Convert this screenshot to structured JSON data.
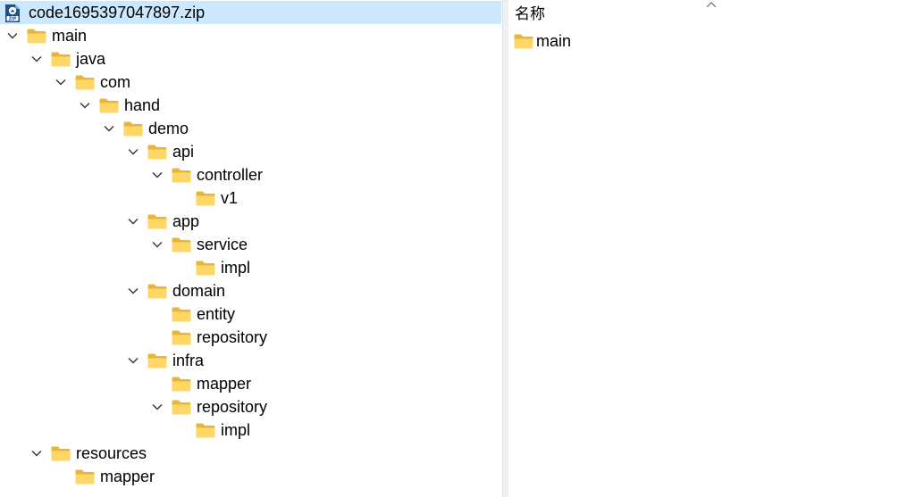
{
  "archive": {
    "name": "code1695397047897.zip",
    "icon": "zip-archive-icon"
  },
  "tree": [
    {
      "label": "main",
      "depth": 0,
      "expanded": true
    },
    {
      "label": "java",
      "depth": 1,
      "expanded": true
    },
    {
      "label": "com",
      "depth": 2,
      "expanded": true
    },
    {
      "label": "hand",
      "depth": 3,
      "expanded": true
    },
    {
      "label": "demo",
      "depth": 4,
      "expanded": true
    },
    {
      "label": "api",
      "depth": 5,
      "expanded": true
    },
    {
      "label": "controller",
      "depth": 6,
      "expanded": true
    },
    {
      "label": "v1",
      "depth": 7,
      "expanded": null
    },
    {
      "label": "app",
      "depth": 5,
      "expanded": true
    },
    {
      "label": "service",
      "depth": 6,
      "expanded": true
    },
    {
      "label": "impl",
      "depth": 7,
      "expanded": null
    },
    {
      "label": "domain",
      "depth": 5,
      "expanded": true
    },
    {
      "label": "entity",
      "depth": 6,
      "expanded": null
    },
    {
      "label": "repository",
      "depth": 6,
      "expanded": null
    },
    {
      "label": "infra",
      "depth": 5,
      "expanded": true
    },
    {
      "label": "mapper",
      "depth": 6,
      "expanded": null
    },
    {
      "label": "repository",
      "depth": 6,
      "expanded": true
    },
    {
      "label": "impl",
      "depth": 7,
      "expanded": null
    },
    {
      "label": "resources",
      "depth": 1,
      "expanded": true
    },
    {
      "label": "mapper",
      "depth": 2,
      "expanded": null
    }
  ],
  "content": {
    "column_header": "名称",
    "sort_icon": "sort-ascending-icon",
    "items": [
      {
        "label": "main",
        "icon": "folder-icon"
      }
    ]
  },
  "colors": {
    "selected_row": "#cce8ff",
    "folder_body": "#ffd766",
    "folder_tab": "#e8b634"
  }
}
